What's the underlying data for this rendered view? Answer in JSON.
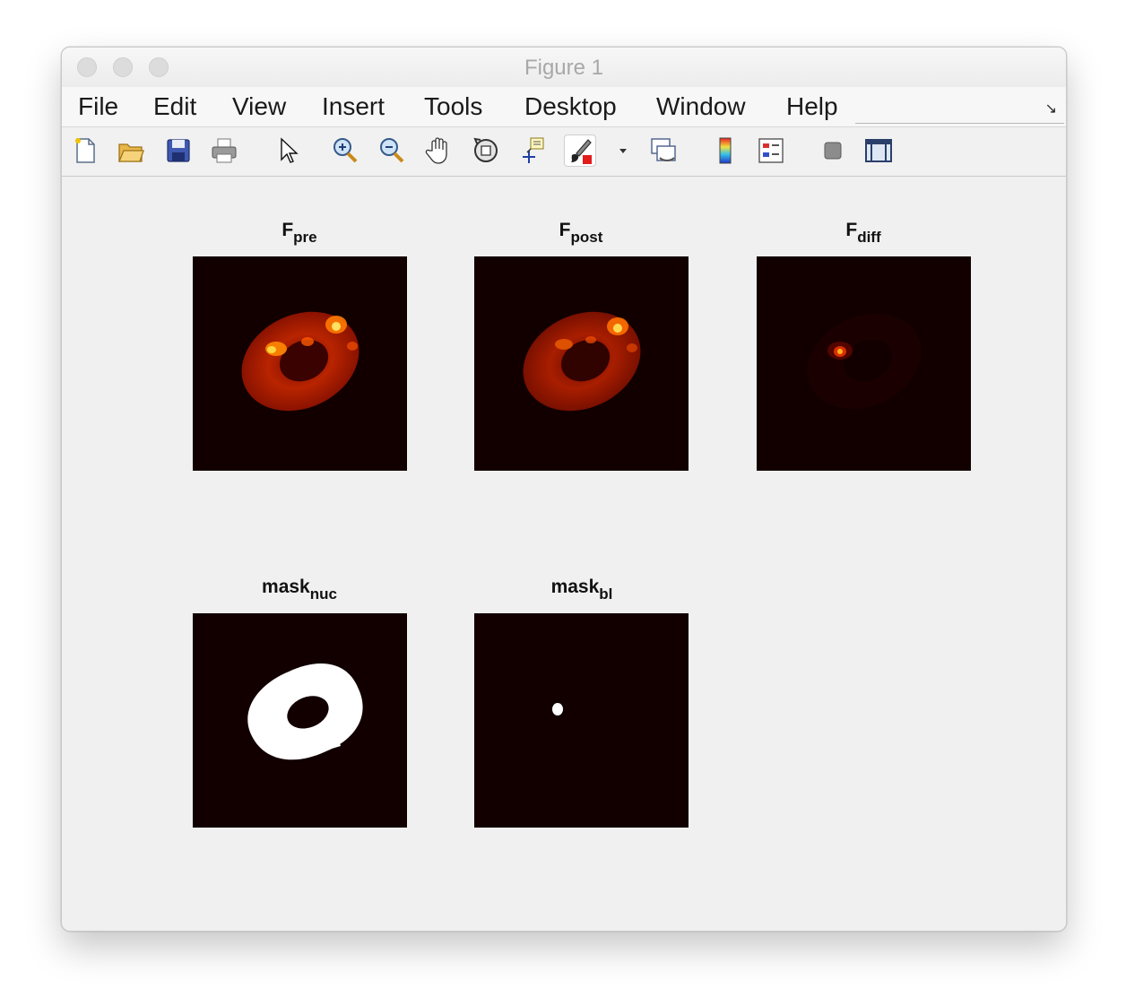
{
  "window": {
    "title": "Figure 1"
  },
  "menu": [
    "File",
    "Edit",
    "View",
    "Insert",
    "Tools",
    "Desktop",
    "Window",
    "Help"
  ],
  "toolbar": {
    "icons": [
      "new-figure-icon",
      "open-file-icon",
      "save-icon",
      "print-icon",
      "select-arrow-icon",
      "zoom-in-icon",
      "zoom-out-icon",
      "pan-hand-icon",
      "rotate-3d-icon",
      "data-cursor-icon",
      "brush-icon",
      "dropdown-arrow-icon",
      "link-plot-icon",
      "colorbar-icon",
      "legend-icon",
      "hide-plot-tools-icon",
      "show-plot-tools-icon"
    ]
  },
  "subplots": [
    {
      "id": "F-pre",
      "title_main": "F",
      "title_sub": "pre",
      "colormap": "hot"
    },
    {
      "id": "F-post",
      "title_main": "F",
      "title_sub": "post",
      "colormap": "hot"
    },
    {
      "id": "F-diff",
      "title_main": "F",
      "title_sub": "diff",
      "colormap": "hot"
    },
    {
      "id": "mask-nuc",
      "title_main": "mask",
      "title_sub": "nuc",
      "colormap": "hot"
    },
    {
      "id": "mask-bl",
      "title_main": "mask",
      "title_sub": "bl",
      "colormap": "hot"
    }
  ],
  "colors": {
    "image_background": "#120000",
    "mask_foreground": "#ffffff",
    "window_background": "#f0f0f0"
  }
}
